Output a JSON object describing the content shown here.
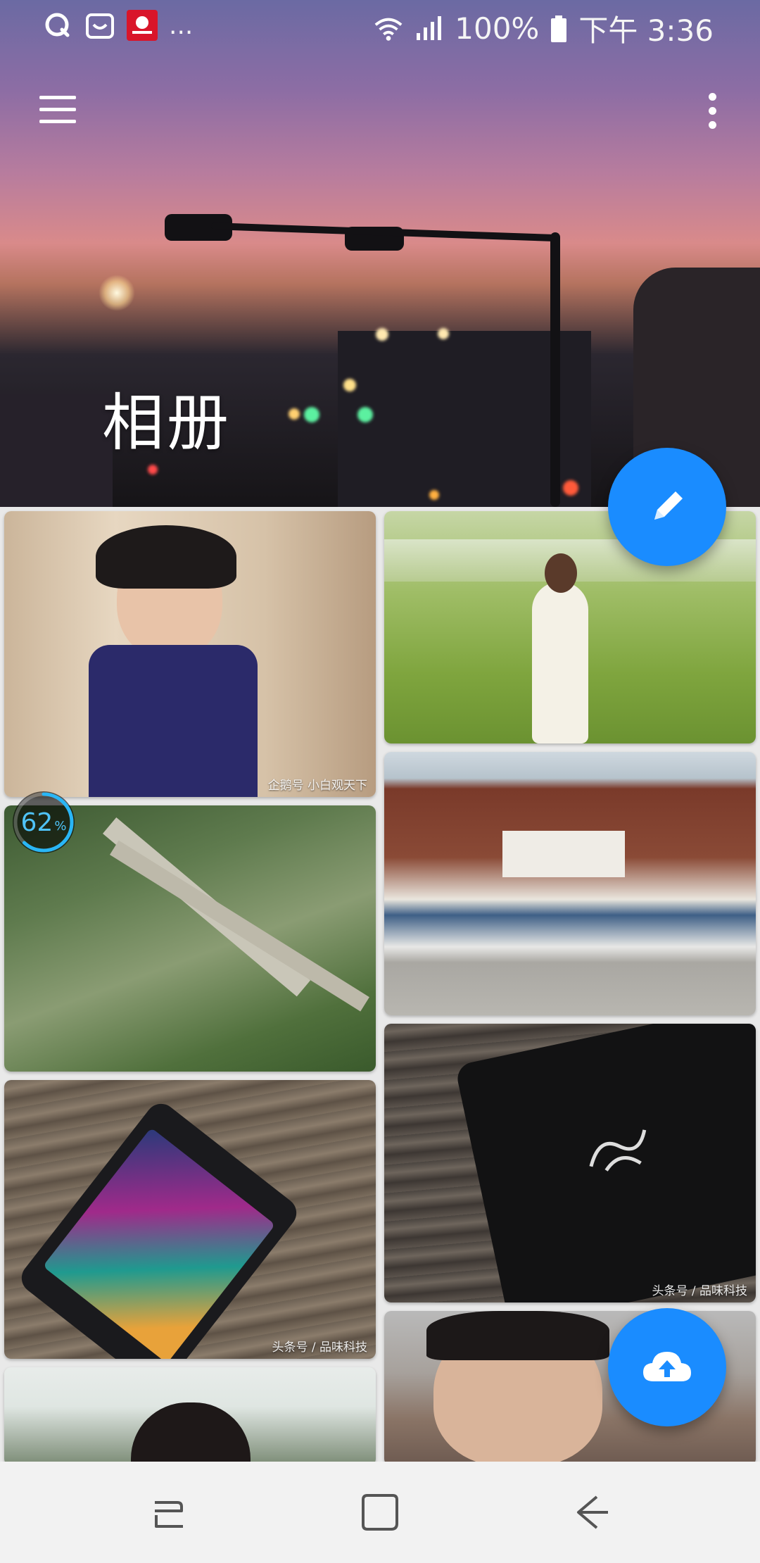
{
  "status_bar": {
    "battery": "100%",
    "time": "下午 3:36",
    "overflow": "...",
    "notification_icons": [
      "qq-browser-icon",
      "shopping-bag-icon",
      "news-app-icon"
    ]
  },
  "header": {
    "title": "相册",
    "menu_icon": "hamburger-menu-icon",
    "overflow_icon": "more-vert-icon"
  },
  "fabs": {
    "edit_icon": "pencil-icon",
    "upload_icon": "cloud-upload-icon",
    "color": "#1a8cff"
  },
  "progress": {
    "value": "62",
    "unit": "%",
    "fraction": 0.62
  },
  "photos": [
    {
      "subject": "woman-in-navy-dress",
      "watermark": "企鹅号 小白观天下"
    },
    {
      "subject": "girl-in-white-dress-meadow",
      "watermark": ""
    },
    {
      "subject": "aerial-airfield",
      "watermark": ""
    },
    {
      "subject": "aircraft-hangar",
      "watermark": ""
    },
    {
      "subject": "smartphone-on-wood",
      "watermark": "头条号 / 品味科技"
    },
    {
      "subject": "phone-back-razer-logo",
      "watermark": "头条号 / 品味科技"
    },
    {
      "subject": "woman-near-window",
      "watermark": ""
    },
    {
      "subject": "man-portrait",
      "watermark": ""
    }
  ],
  "nav_bar": {
    "recent_icon": "recent-apps-icon",
    "home_icon": "home-icon",
    "back_icon": "back-icon"
  }
}
